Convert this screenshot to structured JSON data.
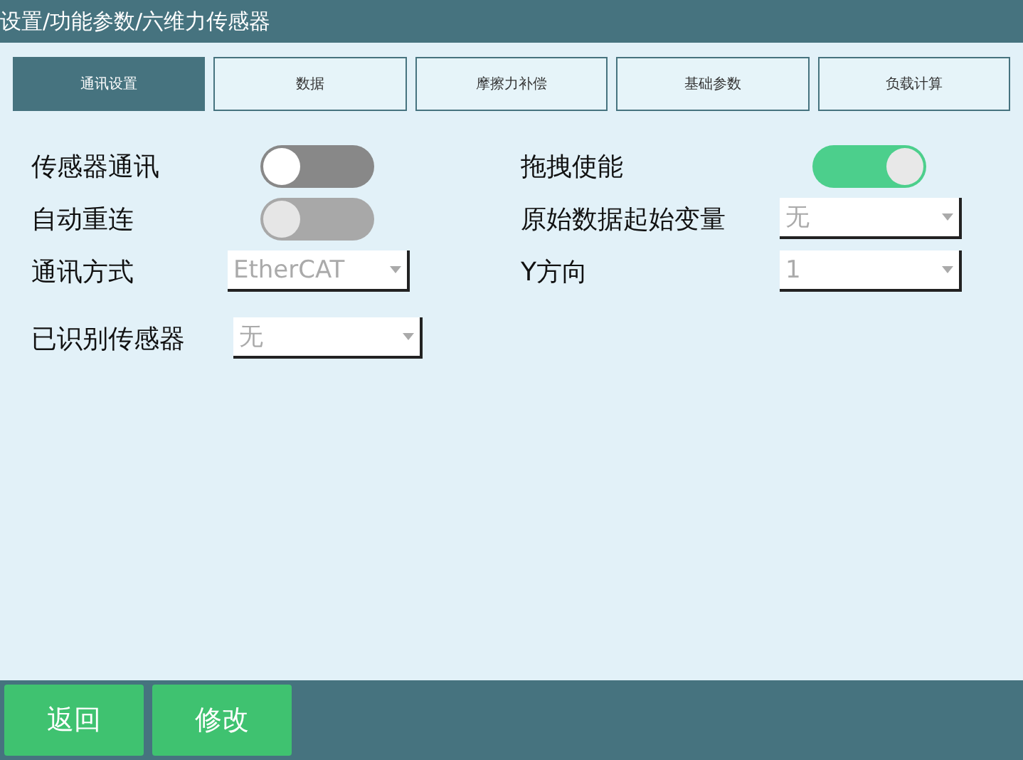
{
  "window": {
    "title": "设置/功能参数/六维力传感器"
  },
  "tabs": [
    {
      "label": "通讯设置",
      "selected": true
    },
    {
      "label": "数据",
      "selected": false
    },
    {
      "label": "摩擦力补偿",
      "selected": false
    },
    {
      "label": "基础参数",
      "selected": false
    },
    {
      "label": "负载计算",
      "selected": false
    }
  ],
  "left_fields": [
    {
      "kind": "toggle",
      "label": "传感器通讯",
      "on": false,
      "disabled": false
    },
    {
      "kind": "toggle",
      "label": "自动重连",
      "on": false,
      "disabled": true
    },
    {
      "kind": "dropdown",
      "label": "通讯方式",
      "value": "EtherCAT"
    },
    {
      "kind": "dropdown",
      "label": "已识别传感器",
      "value": "无"
    }
  ],
  "right_fields": [
    {
      "kind": "toggle",
      "label": "拖拽使能",
      "on": true,
      "disabled": false
    },
    {
      "kind": "dropdown",
      "label": "原始数据起始变量",
      "value": "无"
    },
    {
      "kind": "dropdown",
      "label": "Y方向",
      "value": "1"
    }
  ],
  "buttons": [
    "返回",
    "修改"
  ]
}
